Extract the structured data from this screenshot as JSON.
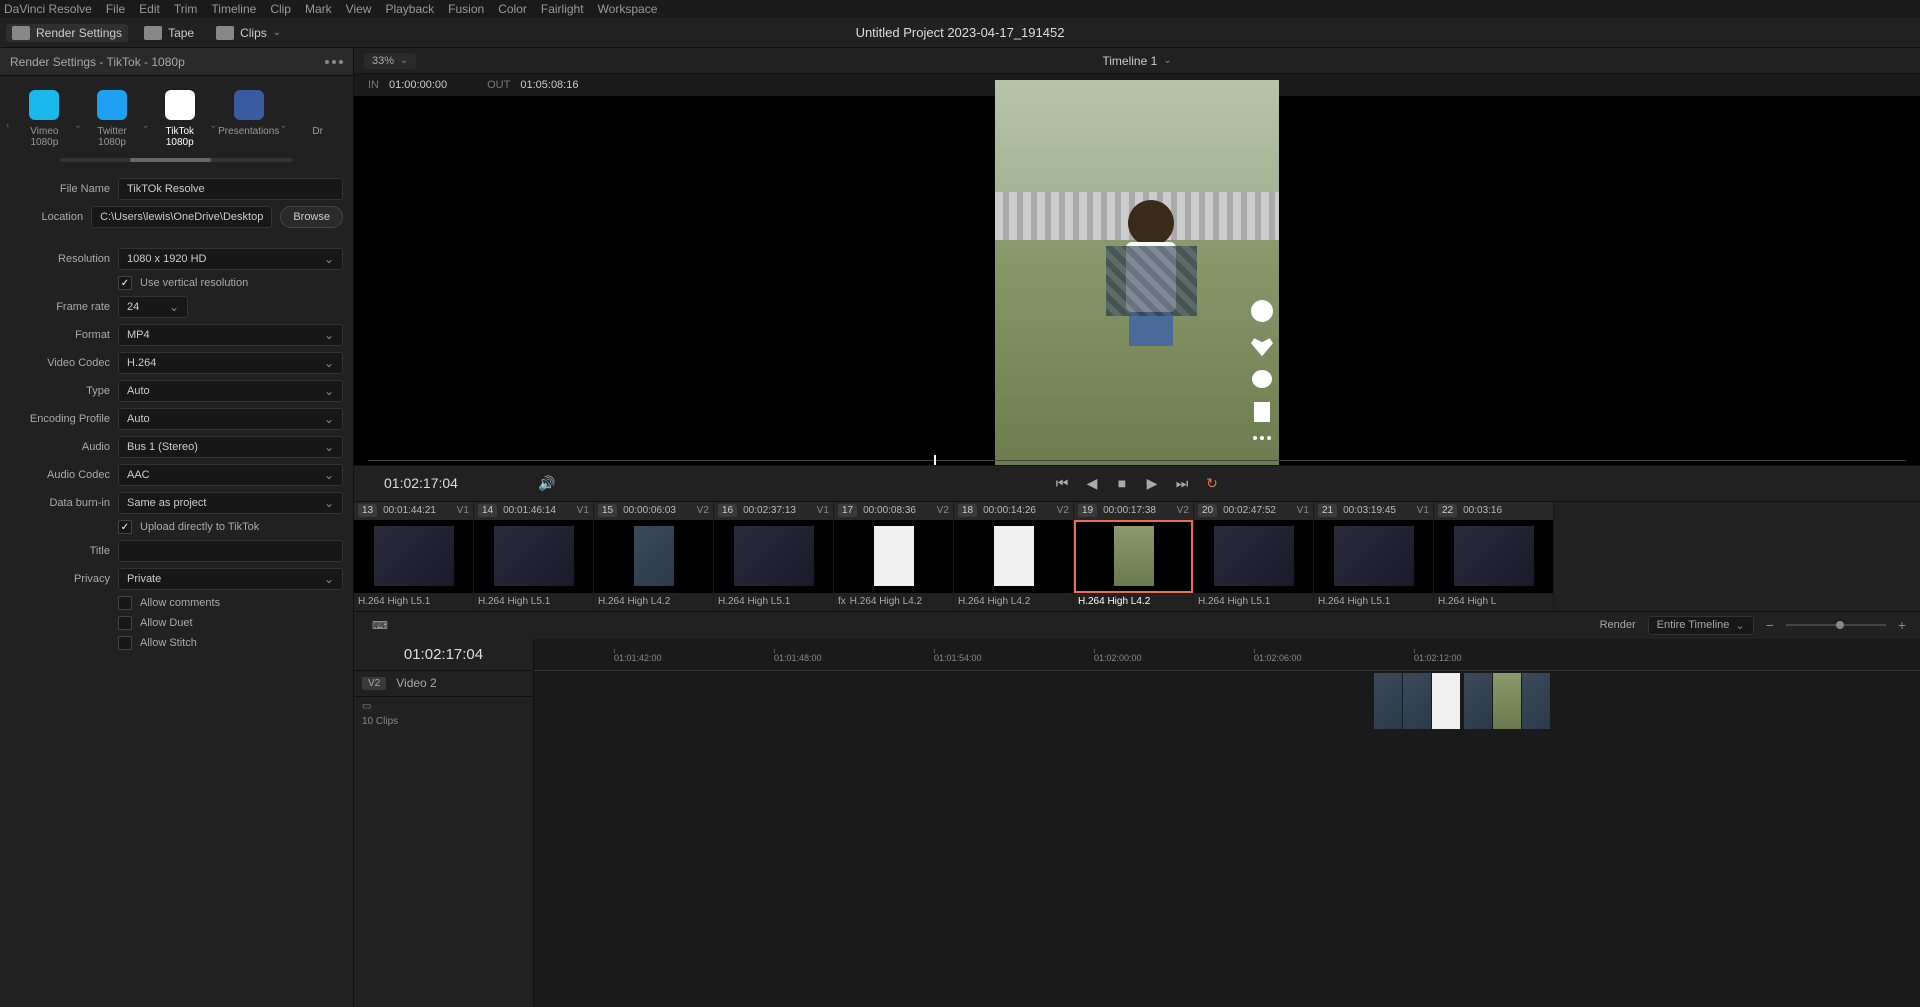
{
  "menu": [
    "DaVinci Resolve",
    "File",
    "Edit",
    "Trim",
    "Timeline",
    "Clip",
    "Mark",
    "View",
    "Playback",
    "Fusion",
    "Color",
    "Fairlight",
    "Workspace"
  ],
  "toolbar": {
    "render_settings": "Render Settings",
    "tape": "Tape",
    "clips": "Clips"
  },
  "project_title": "Untitled Project 2023-04-17_191452",
  "panel_title": "Render Settings - TikTok - 1080p",
  "presets": [
    {
      "label": "Vimeo 1080p",
      "cls": "vimeo"
    },
    {
      "label": "Twitter 1080p",
      "cls": "twitter"
    },
    {
      "label": "TikTok 1080p",
      "cls": "tiktok",
      "active": true
    },
    {
      "label": "Presentations",
      "cls": "pres"
    },
    {
      "label": "Dr",
      "cls": ""
    }
  ],
  "form": {
    "file_name_label": "File Name",
    "file_name": "TikTOk Resolve",
    "location_label": "Location",
    "location": "C:\\Users\\lewis\\OneDrive\\Desktop",
    "browse": "Browse",
    "resolution_label": "Resolution",
    "resolution": "1080 x 1920 HD",
    "use_vertical": "Use vertical resolution",
    "framerate_label": "Frame rate",
    "framerate": "24",
    "format_label": "Format",
    "format": "MP4",
    "codec_label": "Video Codec",
    "codec": "H.264",
    "type_label": "Type",
    "type": "Auto",
    "enc_label": "Encoding Profile",
    "enc": "Auto",
    "audio_label": "Audio",
    "audio": "Bus 1 (Stereo)",
    "acodec_label": "Audio Codec",
    "acodec": "AAC",
    "burn_label": "Data burn-in",
    "burn": "Same as project",
    "upload": "Upload directly to TikTok",
    "title_label": "Title",
    "privacy_label": "Privacy",
    "privacy": "Private",
    "allow_comments": "Allow comments",
    "allow_duet": "Allow Duet",
    "allow_stitch": "Allow Stitch"
  },
  "viewer": {
    "zoom": "33%",
    "timeline_name": "Timeline 1",
    "in_label": "IN",
    "in_tc": "01:00:00:00",
    "out_label": "OUT",
    "out_tc": "01:05:08:16"
  },
  "transport": {
    "current_tc": "01:02:17:04"
  },
  "clips": [
    {
      "num": "13",
      "tc": "00:01:44:21",
      "track": "V1",
      "label": "H.264 High L5.1",
      "thumb": "app"
    },
    {
      "num": "14",
      "tc": "00:01:46:14",
      "track": "V1",
      "label": "H.264 High L5.1",
      "thumb": "app"
    },
    {
      "num": "15",
      "tc": "00:00:06:03",
      "track": "V2",
      "label": "H.264 High L4.2",
      "thumb": ""
    },
    {
      "num": "16",
      "tc": "00:02:37:13",
      "track": "V1",
      "label": "H.264 High L5.1",
      "thumb": "app"
    },
    {
      "num": "17",
      "tc": "00:00:08:36",
      "track": "V2",
      "label": "H.264 High L4.2",
      "thumb": "white",
      "fx": true
    },
    {
      "num": "18",
      "tc": "00:00:14:26",
      "track": "V2",
      "label": "H.264 High L4.2",
      "thumb": "white"
    },
    {
      "num": "19",
      "tc": "00:00:17:38",
      "track": "V2",
      "label": "H.264 High L4.2",
      "thumb": "vid",
      "selected": true
    },
    {
      "num": "20",
      "tc": "00:02:47:52",
      "track": "V1",
      "label": "H.264 High L5.1",
      "thumb": "app"
    },
    {
      "num": "21",
      "tc": "00:03:19:45",
      "track": "V1",
      "label": "H.264 High L5.1",
      "thumb": "app"
    },
    {
      "num": "22",
      "tc": "00:03:16",
      "track": "",
      "label": "H.264 High L",
      "thumb": "app"
    }
  ],
  "render_bar": {
    "render_label": "Render",
    "scope": "Entire Timeline"
  },
  "timeline": {
    "tc": "01:02:17:04",
    "track_badge": "V2",
    "track_name": "Video 2",
    "clip_count": "10 Clips",
    "ticks": [
      "01:01:42:00",
      "01:01:48:00",
      "01:01:54:00",
      "01:02:00:00",
      "01:02:06:00",
      "01:02:12:00"
    ]
  }
}
